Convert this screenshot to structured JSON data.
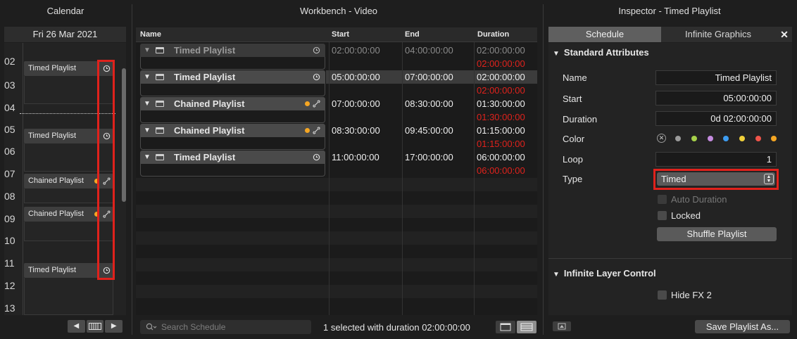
{
  "calendar": {
    "title": "Calendar",
    "date": "Fri 26 Mar 2021",
    "hours": [
      "02",
      "03",
      "04",
      "05",
      "06",
      "07",
      "08",
      "09",
      "10",
      "11",
      "12",
      "13"
    ],
    "events": [
      {
        "label": "Timed Playlist",
        "icon": "clock-icon"
      },
      {
        "label": "Timed Playlist",
        "icon": "clock-icon"
      },
      {
        "label": "Chained Playlist",
        "icon": "link-icon",
        "dot_color": "#f5a623"
      },
      {
        "label": "Chained Playlist",
        "icon": "link-icon",
        "dot_color": "#f5a623"
      },
      {
        "label": "Timed Playlist",
        "icon": "clock-icon"
      }
    ],
    "nav": {
      "prev": "◀",
      "next": "▶"
    }
  },
  "workbench": {
    "title": "Workbench - Video",
    "columns": {
      "name": "Name",
      "start": "Start",
      "end": "End",
      "duration": "Duration"
    },
    "rows": [
      {
        "name": "Timed Playlist",
        "start": "02:00:00:00",
        "end": "04:00:00:00",
        "duration": "02:00:00:00",
        "remaining": "02:00:00:00",
        "icon": "clock-icon",
        "dimmed": true
      },
      {
        "name": "Timed Playlist",
        "start": "05:00:00:00",
        "end": "07:00:00:00",
        "duration": "02:00:00:00",
        "remaining": "02:00:00:00",
        "icon": "clock-icon",
        "selected": true
      },
      {
        "name": "Chained Playlist",
        "start": "07:00:00:00",
        "end": "08:30:00:00",
        "duration": "01:30:00:00",
        "remaining": "01:30:00:00",
        "icon": "link-icon"
      },
      {
        "name": "Chained Playlist",
        "start": "08:30:00:00",
        "end": "09:45:00:00",
        "duration": "01:15:00:00",
        "remaining": "01:15:00:00",
        "icon": "link-icon"
      },
      {
        "name": "Timed Playlist",
        "start": "11:00:00:00",
        "end": "17:00:00:00",
        "duration": "06:00:00:00",
        "remaining": "06:00:00:00",
        "icon": "clock-icon"
      }
    ],
    "search_placeholder": "Search Schedule",
    "status": "1 selected with duration 02:00:00:00"
  },
  "inspector": {
    "title": "Inspector - Timed Playlist",
    "tabs": [
      "Schedule",
      "Infinite Graphics"
    ],
    "close": "✕",
    "standard": {
      "header": "Standard Attributes",
      "name_label": "Name",
      "name_value": "Timed Playlist",
      "start_label": "Start",
      "start_value": "05:00:00:00",
      "duration_label": "Duration",
      "duration_value": "0d 02:00:00:00",
      "color_label": "Color",
      "colors": [
        "#9a9a9a",
        "#a6d14a",
        "#c58be0",
        "#3d9cf0",
        "#f0d03a",
        "#f0544a",
        "#f5a623"
      ],
      "loop_label": "Loop",
      "loop_value": "1",
      "type_label": "Type",
      "type_value": "Timed",
      "auto_duration": "Auto Duration",
      "locked": "Locked",
      "shuffle": "Shuffle Playlist"
    },
    "infinite": {
      "header": "Infinite Layer Control",
      "hide_fx": "Hide FX 2"
    },
    "save": "Save Playlist As..."
  }
}
